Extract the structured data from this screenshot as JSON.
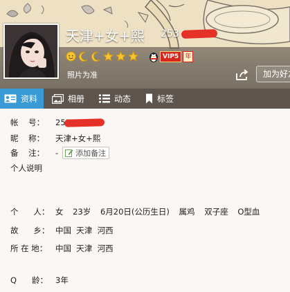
{
  "profile": {
    "nickname": "天津+女+熙",
    "number_visible": "253",
    "photo_real": "照片为准",
    "add_friend": "加为好友"
  },
  "badges": {
    "levels": [
      "sun",
      "moon",
      "moon",
      "star",
      "star",
      "star"
    ],
    "vip": "VIP5",
    "year": "年"
  },
  "tabs": [
    {
      "label": "资料",
      "icon": "profile-card-icon",
      "active": true
    },
    {
      "label": "相册",
      "icon": "album-icon",
      "active": false
    },
    {
      "label": "动态",
      "icon": "feed-list-icon",
      "active": false
    },
    {
      "label": "标签",
      "icon": "bookmark-icon",
      "active": false
    }
  ],
  "info": {
    "account_label": "帐    号：",
    "account_value": "253",
    "nickname_label": "昵    称：",
    "nickname_value": "天津+女+熙",
    "remark_label": "备    注：",
    "remark_value": "-",
    "add_remark": "添加备注",
    "bio_label": "个人说明",
    "person_label": "个      人：",
    "person": {
      "gender": "女",
      "age": "23岁",
      "birthday": "6月20日(公历生日)",
      "zodiac": "属鸡",
      "constellation": "双子座",
      "blood": "O型血"
    },
    "hometown_label": "故      乡：",
    "hometown": "中国  天津  河西",
    "location_label": "所 在 地：",
    "location": "中国  天津  河西",
    "qage_label": "Q      龄：",
    "qage": "3年"
  },
  "colors": {
    "active_tab": "#3a9ad6",
    "tab_bar": "#5d554d",
    "redaction": "#e53127"
  }
}
